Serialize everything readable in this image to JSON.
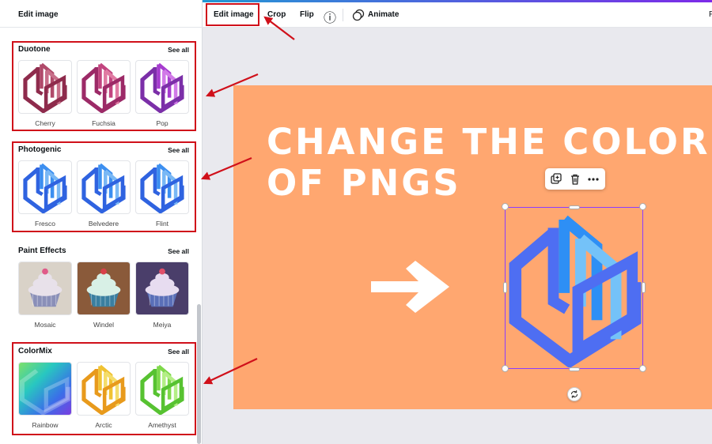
{
  "panel": {
    "title": "Edit image",
    "sections": [
      {
        "title": "Duotone",
        "see_all": "See all",
        "items": [
          {
            "label": "Cherry",
            "colors": [
              "#8e2b4c",
              "#b04a6a",
              "#c8708a"
            ]
          },
          {
            "label": "Fuchsia",
            "colors": [
              "#9c2a67",
              "#c2447f",
              "#e07aa2"
            ]
          },
          {
            "label": "Pop",
            "colors": [
              "#7b2fa8",
              "#a63ccf",
              "#d17ae8"
            ]
          }
        ]
      },
      {
        "title": "Photogenic",
        "see_all": "See all",
        "items": [
          {
            "label": "Fresco",
            "colors": [
              "#2f63e0",
              "#3c8ff0",
              "#79b8f5"
            ]
          },
          {
            "label": "Belvedere",
            "colors": [
              "#2f63e0",
              "#3c8ff0",
              "#79b8f5"
            ]
          },
          {
            "label": "Flint",
            "colors": [
              "#2f63e0",
              "#3c8ff0",
              "#79b8f5"
            ]
          }
        ]
      },
      {
        "title": "Paint Effects",
        "see_all": "See all",
        "items": [
          {
            "label": "Mosaic"
          },
          {
            "label": "Windel"
          },
          {
            "label": "Meiya"
          }
        ]
      },
      {
        "title": "ColorMix",
        "see_all": "See all",
        "items": [
          {
            "label": "Rainbow"
          },
          {
            "label": "Arctic",
            "colors": [
              "#e89a1c",
              "#f0c232",
              "#f4dd6a"
            ]
          },
          {
            "label": "Amethyst",
            "colors": [
              "#57c231",
              "#7ed84a",
              "#b4ee86"
            ]
          }
        ]
      }
    ]
  },
  "toolbar": {
    "edit_image": "Edit image",
    "crop": "Crop",
    "flip": "Flip",
    "info_icon": "ⓘ",
    "animate": "Animate",
    "right_label": "F"
  },
  "design": {
    "headline_line1": "CHANGE THE COLOR",
    "headline_line2": "OF PNGS",
    "background": "#ffa770",
    "graphic_colors": [
      "#4e6ef2",
      "#2e8ff5",
      "#74c2f8"
    ]
  },
  "annotation": {
    "color": "#d0101a"
  }
}
